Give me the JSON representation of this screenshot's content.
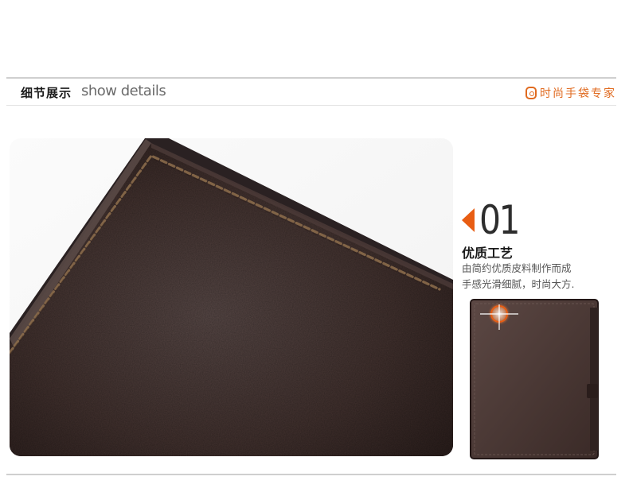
{
  "header": {
    "title_cn": "细节展示",
    "title_en": "show details",
    "brand_text": "时尚手袋专家",
    "brand_icon": "bag-logo-icon",
    "brand_color": "#e06a1f"
  },
  "feature": {
    "number": "01",
    "title": "优质工艺",
    "desc_line1": "由简约优质皮料制作而成",
    "desc_line2": "手感光滑细腻，时尚大方.",
    "accent_color": "#e85d13"
  },
  "images": {
    "detail_photo": "leather-closeup-image",
    "wallet_thumb": "wallet-thumbnail-image"
  }
}
